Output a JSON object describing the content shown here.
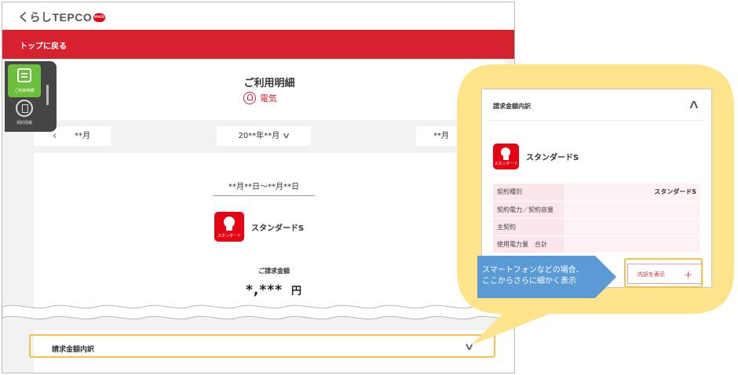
{
  "header": {
    "logo_text": "くらしTEPCO",
    "logo_badge": "web",
    "back_link": "トップに戻る"
  },
  "side_tabs": {
    "usage_top": "ご利用明細",
    "usage_label": "ご利用明細",
    "contract_label": "契約情報"
  },
  "main": {
    "title": "ご利用明細",
    "category": "電気",
    "prev_month": "**月",
    "current_month": "20**年**月",
    "next_month": "**月",
    "period": "**月**日～**月**日",
    "plan_name": "スタンダードS",
    "plan_icon_caption": "スタンダード",
    "billing_label": "ご請求金額",
    "billing_amount": "*,*** ",
    "billing_unit": "円",
    "breakdown_title": "請求金額内訳"
  },
  "detail": {
    "title": "請求金額内訳",
    "plan_name": "スタンダードS",
    "rows": [
      {
        "key": "契約種別",
        "value": "スタンダードS"
      },
      {
        "key": "契約電力／契約容量",
        "value": ""
      },
      {
        "key": "主契約",
        "value": ""
      },
      {
        "key": "使用電力量　合計",
        "value": ""
      }
    ],
    "show_detail_button": "内訳を表示",
    "show_detail_plus": "＋"
  },
  "note": {
    "line1": "スマートフォンなどの場合、",
    "line2": "ここからさらに細かく表示"
  },
  "colors": {
    "brand_red": "#d7212f",
    "highlight_yellow": "#f2c14e",
    "callout_fill": "#fde48a",
    "note_blue": "#5b9bd5"
  }
}
